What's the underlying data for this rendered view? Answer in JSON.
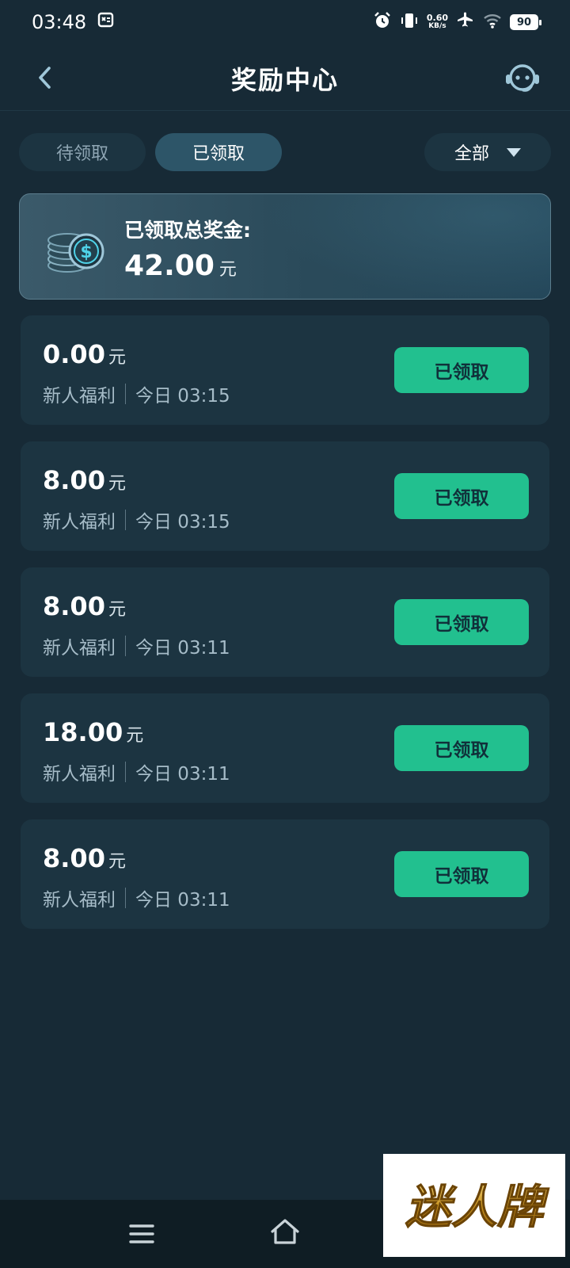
{
  "status_bar": {
    "time": "03:48",
    "net_speed_value": "0.60",
    "net_speed_unit": "KB/s",
    "battery": "90"
  },
  "header": {
    "title": "奖励中心"
  },
  "tabs": [
    {
      "label": "待领取",
      "active": false
    },
    {
      "label": "已领取",
      "active": true
    }
  ],
  "filter": {
    "selected": "全部"
  },
  "summary": {
    "label": "已领取总奖金:",
    "amount": "42.00",
    "unit": "元"
  },
  "rewards": [
    {
      "amount": "0.00",
      "unit": "元",
      "type": "新人福利",
      "time": "今日 03:15",
      "status": "已领取"
    },
    {
      "amount": "8.00",
      "unit": "元",
      "type": "新人福利",
      "time": "今日 03:15",
      "status": "已领取"
    },
    {
      "amount": "8.00",
      "unit": "元",
      "type": "新人福利",
      "time": "今日 03:11",
      "status": "已领取"
    },
    {
      "amount": "18.00",
      "unit": "元",
      "type": "新人福利",
      "time": "今日 03:11",
      "status": "已领取"
    },
    {
      "amount": "8.00",
      "unit": "元",
      "type": "新人福利",
      "time": "今日 03:11",
      "status": "已领取"
    }
  ],
  "watermark": {
    "text": "迷人牌"
  },
  "colors": {
    "background": "#172a36",
    "card": "#1c3441",
    "accent_green": "#22c08f",
    "active_tab": "#2d5568"
  }
}
